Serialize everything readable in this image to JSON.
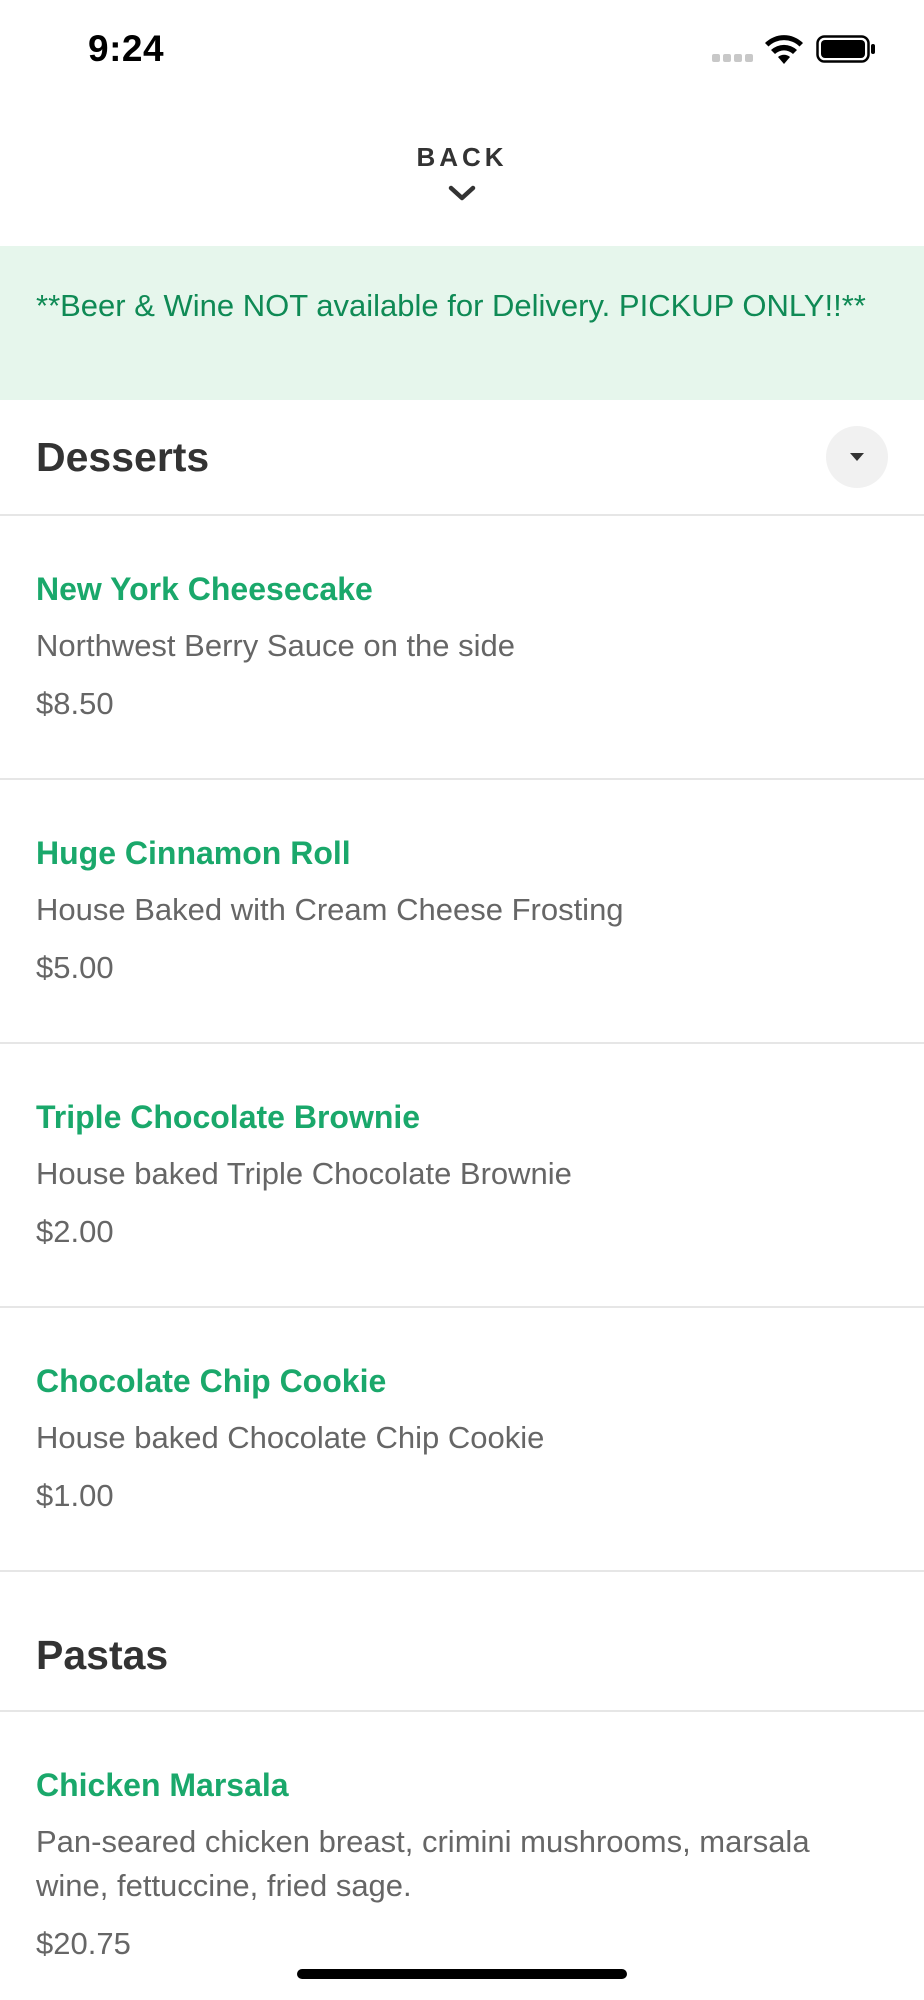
{
  "status_bar": {
    "time": "9:24"
  },
  "header": {
    "back_label": "BACK"
  },
  "banner": {
    "text": "**Beer & Wine NOT available for Delivery. PICKUP ONLY!!**",
    "background_color": "#e6f6ec",
    "text_color": "#0f8a55"
  },
  "theme": {
    "accent_color": "#1aa86b",
    "title_color": "#333333",
    "body_color": "#666666"
  },
  "sections": [
    {
      "title": "Desserts",
      "collapse_icon": "caret-down-icon",
      "items": [
        {
          "name": "New York Cheesecake",
          "description": "Northwest Berry Sauce on the side",
          "price": "$8.50"
        },
        {
          "name": "Huge Cinnamon Roll",
          "description": "House Baked with Cream Cheese Frosting",
          "price": "$5.00"
        },
        {
          "name": "Triple Chocolate Brownie",
          "description": "House baked Triple Chocolate Brownie",
          "price": "$2.00"
        },
        {
          "name": "Chocolate Chip Cookie",
          "description": "House baked Chocolate Chip Cookie",
          "price": "$1.00"
        }
      ]
    },
    {
      "title": "Pastas",
      "items": [
        {
          "name": "Chicken Marsala",
          "description": "Pan-seared chicken breast, crimini mushrooms, marsala wine, fettuccine, fried sage.",
          "price": "$20.75"
        }
      ]
    }
  ]
}
